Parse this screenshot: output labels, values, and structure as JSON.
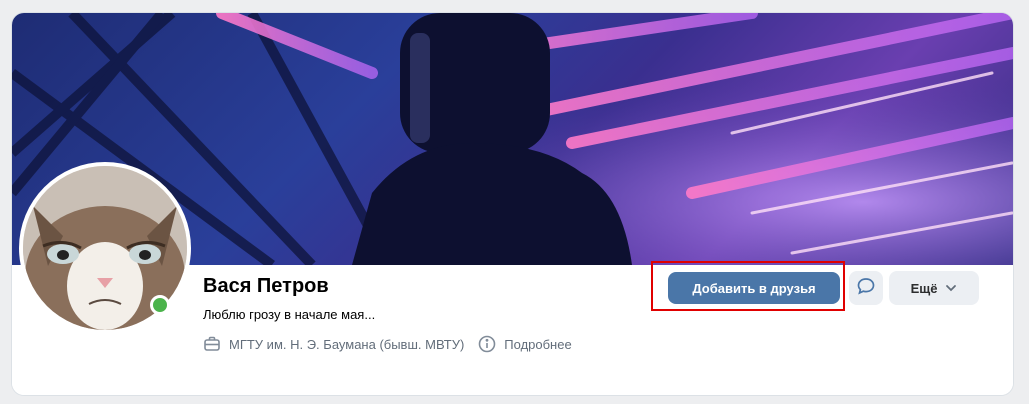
{
  "profile": {
    "name": "Вася Петров",
    "status": "Люблю грозу в начале мая...",
    "online": true,
    "education": "МГТУ им. Н. Э. Баумана (бывш. МВТУ)",
    "more_info": "Подробнее"
  },
  "actions": {
    "add_friend": "Добавить в друзья",
    "more": "Ещё"
  },
  "icons": {
    "education": "briefcase-icon",
    "info": "info-icon",
    "message": "message-icon",
    "dropdown": "chevron-down-icon"
  },
  "colors": {
    "primary": "#4a76a8",
    "online": "#4bb34b",
    "highlight": "#e00000",
    "secondary_bg": "#eceff3"
  }
}
